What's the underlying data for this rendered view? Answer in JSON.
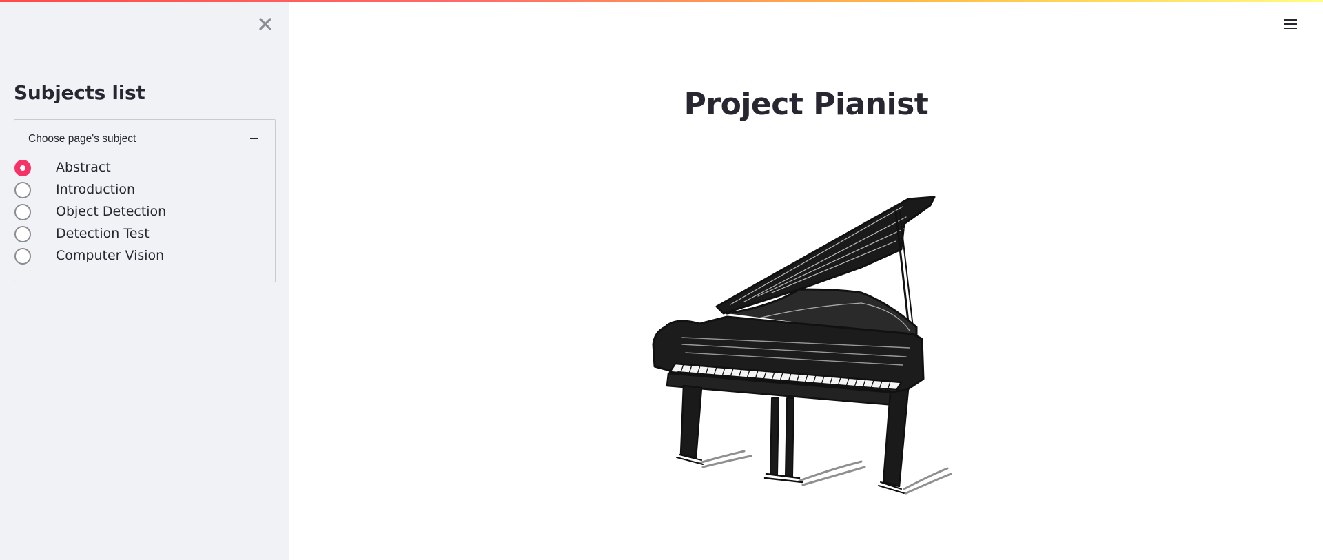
{
  "sidebar": {
    "close_icon": "close-icon",
    "title": "Subjects list",
    "expander": {
      "label": "Choose page's subject",
      "toggle_icon": "minus-icon",
      "options": [
        {
          "label": "Abstract",
          "selected": true
        },
        {
          "label": "Introduction",
          "selected": false
        },
        {
          "label": "Object Detection",
          "selected": false
        },
        {
          "label": "Detection Test",
          "selected": false
        },
        {
          "label": "Computer Vision",
          "selected": false
        }
      ]
    }
  },
  "header": {
    "menu_icon": "hamburger-menu-icon"
  },
  "main": {
    "title": "Project Pianist",
    "image": "grand-piano-sketch"
  },
  "colors": {
    "accent": "#f63366",
    "sidebar_bg": "#f0f2f6",
    "text": "#262730",
    "radio_border": "#8b8d95"
  }
}
